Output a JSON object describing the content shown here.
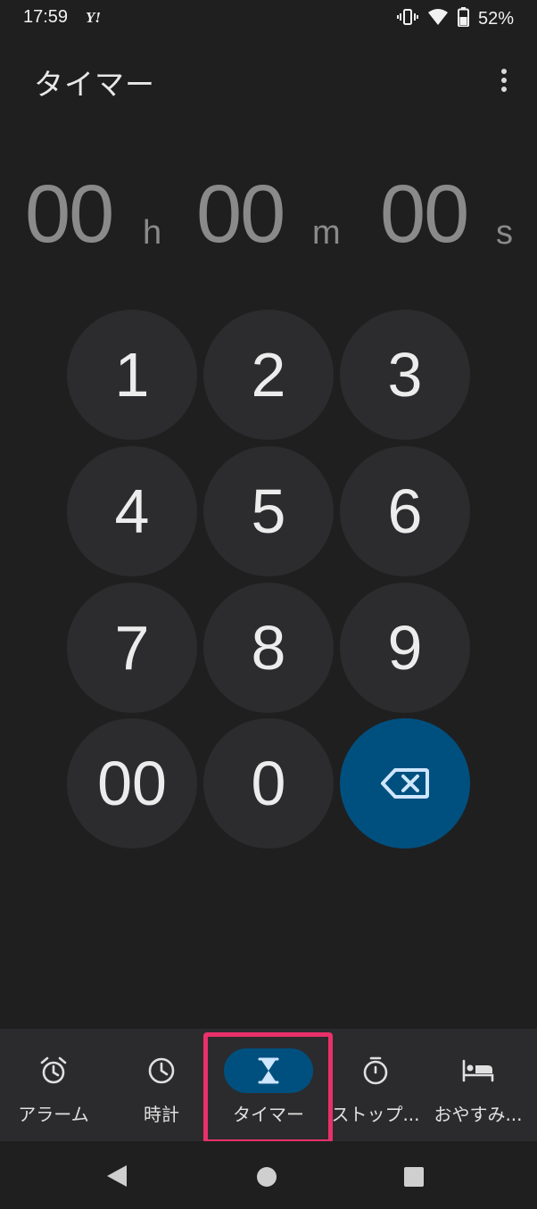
{
  "status": {
    "time": "17:59",
    "carrier_logo": "Y!",
    "battery": "52%",
    "icons": [
      "vibrate-icon",
      "wifi-icon",
      "battery-icon"
    ]
  },
  "header": {
    "title": "タイマー",
    "menu_icon": "more-vert-icon"
  },
  "timer": {
    "hours": "00",
    "hours_unit": "h",
    "minutes": "00",
    "minutes_unit": "m",
    "seconds": "00",
    "seconds_unit": "s"
  },
  "keypad": {
    "keys": [
      "1",
      "2",
      "3",
      "4",
      "5",
      "6",
      "7",
      "8",
      "9",
      "00",
      "0"
    ],
    "backspace_icon": "backspace-icon"
  },
  "nav": {
    "items": [
      {
        "label": "アラーム",
        "icon": "alarm-icon"
      },
      {
        "label": "時計",
        "icon": "clock-icon"
      },
      {
        "label": "タイマー",
        "icon": "hourglass-icon"
      },
      {
        "label": "ストップ...",
        "icon": "stopwatch-icon"
      },
      {
        "label": "おやすみ...",
        "icon": "bed-icon"
      }
    ],
    "active_index": 2
  },
  "system_nav": {
    "icons": [
      "back-icon",
      "home-icon",
      "recents-icon"
    ]
  },
  "colors": {
    "background": "#1f1f1f",
    "key": "#2c2c2e",
    "accent": "#00507f",
    "accent_icon": "#cfe6ff",
    "highlight": "#e8306a",
    "time_digits": "#8a8a8a"
  }
}
